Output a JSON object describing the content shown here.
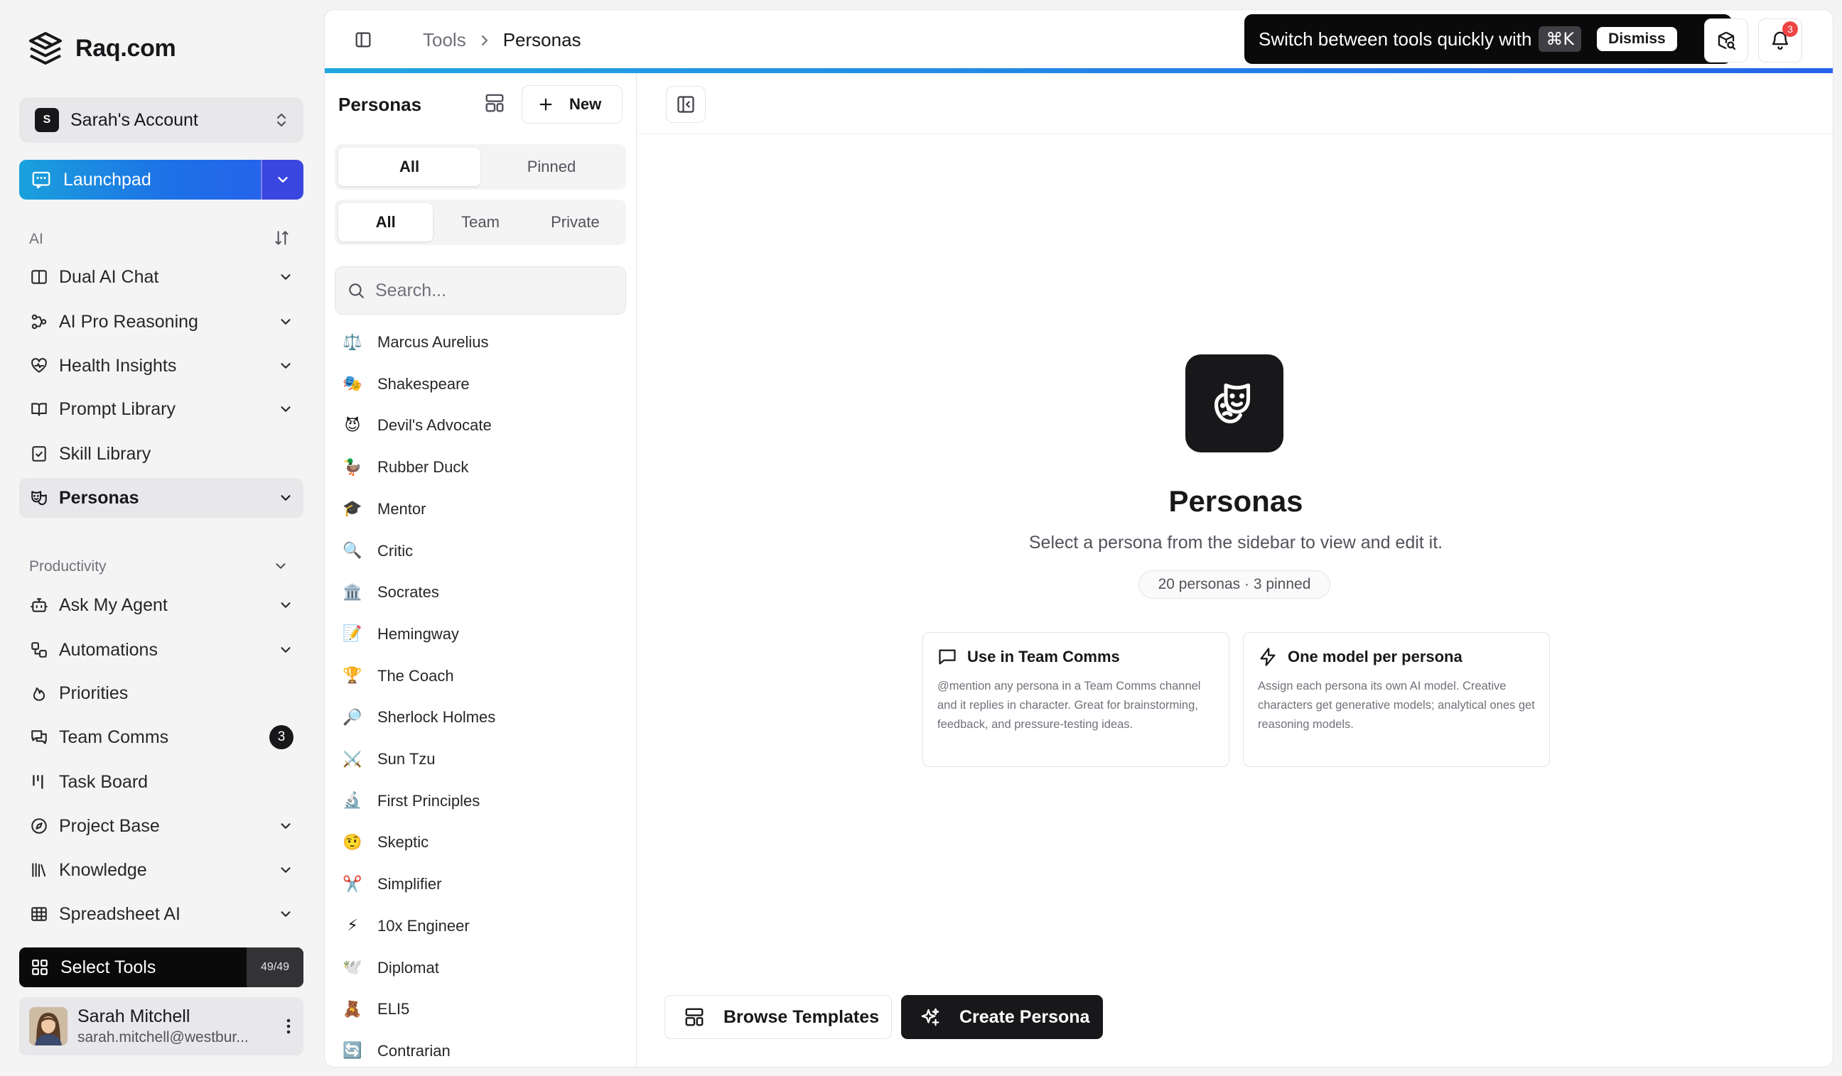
{
  "app": {
    "name": "Raq.com"
  },
  "account": {
    "initial": "S",
    "name": "Sarah's Account"
  },
  "launchpad": {
    "label": "Launchpad"
  },
  "sections": {
    "ai": "AI",
    "productivity": "Productivity"
  },
  "nav": {
    "dual_ai_chat": "Dual AI Chat",
    "ai_pro_reasoning": "AI Pro Reasoning",
    "health_insights": "Health Insights",
    "prompt_library": "Prompt Library",
    "skill_library": "Skill Library",
    "personas": "Personas",
    "ask_my_agent": "Ask My Agent",
    "automations": "Automations",
    "priorities": "Priorities",
    "team_comms": "Team Comms",
    "team_comms_count": "3",
    "task_board": "Task Board",
    "project_base": "Project Base",
    "knowledge": "Knowledge",
    "spreadsheet_ai": "Spreadsheet AI"
  },
  "select_tools": {
    "label": "Select Tools",
    "count": "49/49"
  },
  "user": {
    "name": "Sarah Mitchell",
    "email": "sarah.mitchell@westbur..."
  },
  "breadcrumb": {
    "parent": "Tools",
    "current": "Personas"
  },
  "tooltip": {
    "text": "Switch between tools quickly with",
    "shortcut": "⌘K",
    "dismiss": "Dismiss"
  },
  "notifications": {
    "count": "3"
  },
  "persona_panel": {
    "title": "Personas",
    "new_label": "New",
    "filter_1": {
      "all": "All",
      "pinned": "Pinned"
    },
    "filter_2": {
      "all": "All",
      "team": "Team",
      "private": "Private"
    },
    "search_placeholder": "Search...",
    "items": [
      {
        "emoji": "⚖️",
        "name": "Marcus Aurelius"
      },
      {
        "emoji": "🎭",
        "name": "Shakespeare"
      },
      {
        "emoji": "😈",
        "name": "Devil's Advocate"
      },
      {
        "emoji": "🦆",
        "name": "Rubber Duck"
      },
      {
        "emoji": "🎓",
        "name": "Mentor"
      },
      {
        "emoji": "🔍",
        "name": "Critic"
      },
      {
        "emoji": "🏛️",
        "name": "Socrates"
      },
      {
        "emoji": "📝",
        "name": "Hemingway"
      },
      {
        "emoji": "🏆",
        "name": "The Coach"
      },
      {
        "emoji": "🔎",
        "name": "Sherlock Holmes"
      },
      {
        "emoji": "⚔️",
        "name": "Sun Tzu"
      },
      {
        "emoji": "🔬",
        "name": "First Principles"
      },
      {
        "emoji": "🤨",
        "name": "Skeptic"
      },
      {
        "emoji": "✂️",
        "name": "Simplifier"
      },
      {
        "emoji": "⚡",
        "name": "10x Engineer"
      },
      {
        "emoji": "🕊️",
        "name": "Diplomat"
      },
      {
        "emoji": "🧸",
        "name": "ELI5"
      },
      {
        "emoji": "🔄",
        "name": "Contrarian"
      }
    ]
  },
  "detail": {
    "title": "Personas",
    "subtitle": "Select a persona from the sidebar to view and edit it.",
    "stats": "20 personas · 3 pinned",
    "cards": [
      {
        "title": "Use in Team Comms",
        "desc": "@mention any persona in a Team Comms channel and it replies in character. Great for brainstorming, feedback, and pressure-testing ideas."
      },
      {
        "title": "One model per persona",
        "desc": "Assign each persona its own AI model. Creative characters get generative models; analytical ones get reasoning models."
      }
    ],
    "browse_label": "Browse Templates",
    "create_label": "Create Persona"
  },
  "colors": {
    "accent_start": "#22a7e0",
    "accent_end": "#2563eb",
    "dark": "#18181b",
    "badge_red": "#ef4444"
  }
}
